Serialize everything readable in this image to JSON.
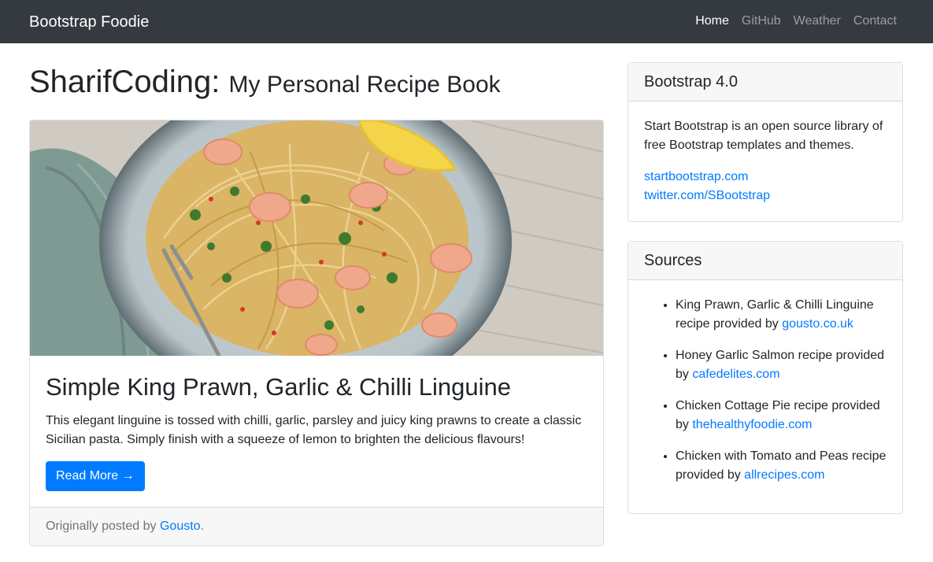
{
  "navbar": {
    "brand": "Bootstrap Foodie",
    "links": [
      "Home",
      "GitHub",
      "Weather",
      "Contact"
    ]
  },
  "heading": {
    "title": "SharifCoding:",
    "subtitle": "My Personal Recipe Book"
  },
  "post": {
    "image_alt": "Plate of king prawn, garlic and chilli linguine with lemon wedge",
    "title": "Simple King Prawn, Garlic & Chilli Linguine",
    "excerpt": "This elegant linguine is tossed with chilli, garlic, parsley and juicy king prawns to create a classic Sicilian pasta. Simply finish with a squeeze of lemon to brighten the delicious flavours!",
    "button_label": "Read More →",
    "footer_prefix": "Originally posted by",
    "footer_link": "Gousto",
    "footer_suffix": "."
  },
  "sidebar": {
    "bootstrap_card": {
      "header": "Bootstrap 4.0",
      "description": "Start Bootstrap is an open source library of free Bootstrap templates and themes.",
      "links": [
        "startbootstrap.com",
        "twitter.com/SBootstrap"
      ]
    },
    "sources_card": {
      "header": "Sources",
      "items": [
        {
          "text": "King Prawn, Garlic & Chilli Linguine recipe provided by",
          "link": "gousto.co.uk"
        },
        {
          "text": "Honey Garlic Salmon recipe provided by",
          "link": "cafedelites.com"
        },
        {
          "text": "Chicken Cottage Pie recipe provided by",
          "link": "thehealthyfoodie.com"
        },
        {
          "text": "Chicken with Tomato and Peas recipe provided by",
          "link": "allrecipes.com"
        }
      ]
    }
  },
  "colors": {
    "navbar": "#343a40",
    "link": "#007bff",
    "button": "#007bff",
    "card_header": "#f7f7f7"
  }
}
